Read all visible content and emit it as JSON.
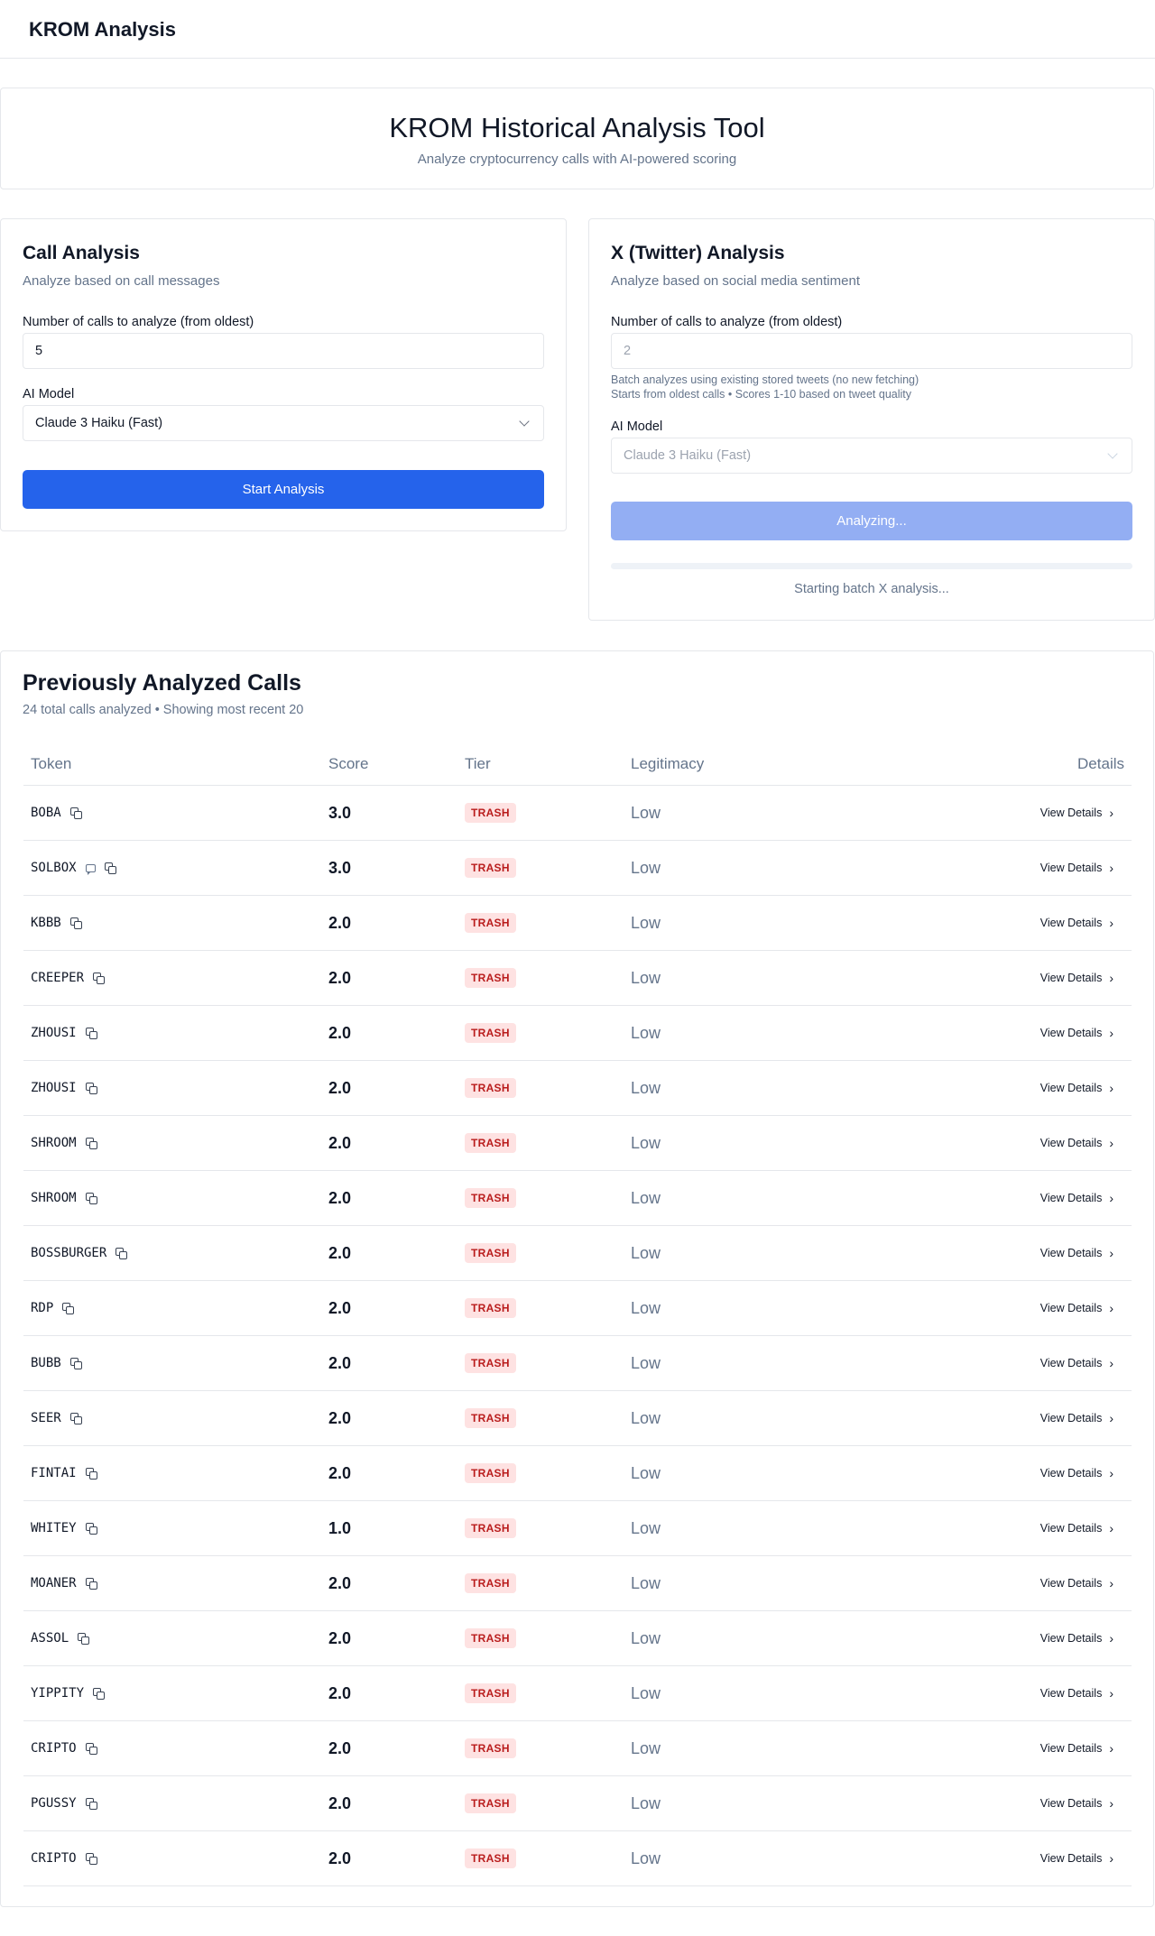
{
  "app": {
    "title": "KROM Analysis"
  },
  "hero": {
    "title": "KROM Historical Analysis Tool",
    "subtitle": "Analyze cryptocurrency calls with AI-powered scoring"
  },
  "call_panel": {
    "title": "Call Analysis",
    "subtitle": "Analyze based on call messages",
    "count_label": "Number of calls to analyze (from oldest)",
    "count_value": "5",
    "model_label": "AI Model",
    "model_value": "Claude 3 Haiku (Fast)",
    "button_label": "Start Analysis"
  },
  "x_panel": {
    "title": "X (Twitter) Analysis",
    "subtitle": "Analyze based on social media sentiment",
    "count_label": "Number of calls to analyze (from oldest)",
    "count_value": "2",
    "hint_line1": "Batch analyzes using existing stored tweets (no new fetching)",
    "hint_line2": "Starts from oldest calls • Scores 1-10 based on tweet quality",
    "model_label": "AI Model",
    "model_value": "Claude 3 Haiku (Fast)",
    "button_label": "Analyzing...",
    "progress": 0,
    "status_text": "Starting batch X analysis..."
  },
  "history": {
    "title": "Previously Analyzed Calls",
    "subtitle": "24 total calls analyzed • Showing most recent 20",
    "columns": {
      "token": "Token",
      "score": "Score",
      "tier": "Tier",
      "legitimacy": "Legitimacy",
      "details": "Details"
    },
    "details_label": "View Details",
    "rows": [
      {
        "token": "BOBA",
        "score": "3.0",
        "tier": "TRASH",
        "legitimacy": "Low",
        "chat": false
      },
      {
        "token": "SOLBOX",
        "score": "3.0",
        "tier": "TRASH",
        "legitimacy": "Low",
        "chat": true
      },
      {
        "token": "KBBB",
        "score": "2.0",
        "tier": "TRASH",
        "legitimacy": "Low",
        "chat": false
      },
      {
        "token": "CREEPER",
        "score": "2.0",
        "tier": "TRASH",
        "legitimacy": "Low",
        "chat": false
      },
      {
        "token": "ZHOUSI",
        "score": "2.0",
        "tier": "TRASH",
        "legitimacy": "Low",
        "chat": false
      },
      {
        "token": "ZHOUSI",
        "score": "2.0",
        "tier": "TRASH",
        "legitimacy": "Low",
        "chat": false
      },
      {
        "token": "SHROOM",
        "score": "2.0",
        "tier": "TRASH",
        "legitimacy": "Low",
        "chat": false
      },
      {
        "token": "SHROOM",
        "score": "2.0",
        "tier": "TRASH",
        "legitimacy": "Low",
        "chat": false
      },
      {
        "token": "BOSSBURGER",
        "score": "2.0",
        "tier": "TRASH",
        "legitimacy": "Low",
        "chat": false
      },
      {
        "token": "RDP",
        "score": "2.0",
        "tier": "TRASH",
        "legitimacy": "Low",
        "chat": false
      },
      {
        "token": "BUBB",
        "score": "2.0",
        "tier": "TRASH",
        "legitimacy": "Low",
        "chat": false
      },
      {
        "token": "SEER",
        "score": "2.0",
        "tier": "TRASH",
        "legitimacy": "Low",
        "chat": false
      },
      {
        "token": "FINTAI",
        "score": "2.0",
        "tier": "TRASH",
        "legitimacy": "Low",
        "chat": false
      },
      {
        "token": "WHITEY",
        "score": "1.0",
        "tier": "TRASH",
        "legitimacy": "Low",
        "chat": false
      },
      {
        "token": "MOANER",
        "score": "2.0",
        "tier": "TRASH",
        "legitimacy": "Low",
        "chat": false
      },
      {
        "token": "ASSOL",
        "score": "2.0",
        "tier": "TRASH",
        "legitimacy": "Low",
        "chat": false
      },
      {
        "token": "YIPPITY",
        "score": "2.0",
        "tier": "TRASH",
        "legitimacy": "Low",
        "chat": false
      },
      {
        "token": "CRIPTO",
        "score": "2.0",
        "tier": "TRASH",
        "legitimacy": "Low",
        "chat": false
      },
      {
        "token": "PGUSSY",
        "score": "2.0",
        "tier": "TRASH",
        "legitimacy": "Low",
        "chat": false
      },
      {
        "token": "CRIPTO",
        "score": "2.0",
        "tier": "TRASH",
        "legitimacy": "Low",
        "chat": false
      }
    ]
  },
  "colors": {
    "primary": "#2563eb",
    "primary_disabled": "#93aef3",
    "tier_bg": "#fee2e2",
    "tier_text": "#b91c1c",
    "muted": "#64748b"
  }
}
